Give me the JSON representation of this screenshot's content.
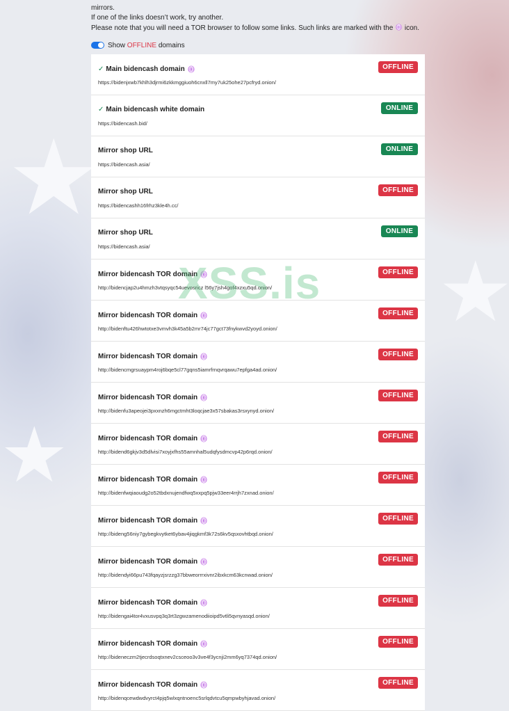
{
  "intro": {
    "line1": "mirrors.",
    "line2": "If one of the links doesn’t work, try another.",
    "line3_before": "Please note that you will need a TOR browser to follow some links. Such links are marked with the",
    "line3_after": "icon."
  },
  "toggle": {
    "label_prefix": "Show",
    "label_offline": "OFFLINE",
    "label_suffix": "domains",
    "enabled": true
  },
  "watermark": "XSS.is",
  "colors": {
    "offline": "#dc3545",
    "online": "#198754",
    "accent": "#1a73e8",
    "tor_icon": "#b24bd8"
  },
  "domains": [
    {
      "title": "Main bidencash domain",
      "url": "https://bidenjxwb7khlh3djrmi6zkkmggiuoh6cnxll7my7uk25ohe27pcfryd.onion/",
      "status": "OFFLINE",
      "tor": true,
      "checked": true
    },
    {
      "title": "Main bidencash white domain",
      "url": "https://bidencash.bid/",
      "status": "ONLINE",
      "tor": false,
      "checked": true
    },
    {
      "title": "Mirror shop URL",
      "url": "https://bidencash.asia/",
      "status": "ONLINE",
      "tor": false,
      "checked": false
    },
    {
      "title": "Mirror shop URL",
      "url": "https://bidencashh16frhz3kle4h.cc/",
      "status": "OFFLINE",
      "tor": false,
      "checked": false
    },
    {
      "title": "Mirror shop URL",
      "url": "https://bidencash.asia/",
      "status": "ONLINE",
      "tor": false,
      "checked": false
    },
    {
      "title": "Mirror bidencash TOR domain",
      "url": "http://bidencjap2u4hmzh3vtqsyqc54uevosricz l56y7jsh4gof4xzxu5qd.onion/",
      "status": "OFFLINE",
      "tor": true,
      "checked": false
    },
    {
      "title": "Mirror bidencash TOR domain",
      "url": "http://bidenftu426hwtotxe3vmvh3k45a5b2mr74jc77gct73fnykwvd2yoyd.onion/",
      "status": "OFFLINE",
      "tor": true,
      "checked": false
    },
    {
      "title": "Mirror bidencash TOR domain",
      "url": "http://bidencmgrsuaypm4roj6bqe5cl77gqns5iamrfrnqvrqawu7epfga4ad.onion/",
      "status": "OFFLINE",
      "tor": true,
      "checked": false
    },
    {
      "title": "Mirror bidencash TOR domain",
      "url": "http://bidenfu3apeojei3pxxnzh6mgctmht3loqcjae3x57sbakas3rsxynyd.onion/",
      "status": "OFFLINE",
      "tor": true,
      "checked": false
    },
    {
      "title": "Mirror bidencash TOR domain",
      "url": "http://bidend6gkjv3d5dlvisi7xoyjxfhs55amnhal5udqfysdmcvp42p6rqd.onion/",
      "status": "OFFLINE",
      "tor": true,
      "checked": false
    },
    {
      "title": "Mirror bidencash TOR domain",
      "url": "http://bidenfwqiaoudg2o52tbdxnujendfwq5xxpq5pjw33eer4rrjh7zxnad.onion/",
      "status": "OFFLINE",
      "tor": true,
      "checked": false
    },
    {
      "title": "Mirror bidencash TOR domain",
      "url": "http://bideng56niy7gybegkvytket6ybav4jiqgkmf3k72s6kv5qsxovhtbqd.onion/",
      "status": "OFFLINE",
      "tor": true,
      "checked": false
    },
    {
      "title": "Mirror bidencash TOR domain",
      "url": "http://bidendyi66pu743fqayzjsrzzg37bbweorrrxivnr2ibxkcm63kcnwad.onion/",
      "status": "OFFLINE",
      "tor": true,
      "checked": false
    },
    {
      "title": "Mirror bidencash TOR domain",
      "url": "http://bidengai4tor4vxusvpq3q3rt3zgwzamenodiioipd5vtli5qvnyasqd.onion/",
      "status": "OFFLINE",
      "tor": true,
      "checked": false
    },
    {
      "title": "Mirror bidencash TOR domain",
      "url": "http://bideneczm2tjecrdsoqtxnev2csceoo3v3ve4f3ycnji2mm6yq7374qd.onion/",
      "status": "OFFLINE",
      "tor": true,
      "checked": false
    },
    {
      "title": "Mirror bidencash TOR domain",
      "url": "http://bidenqcewdwdvyrct4pjq5wlxqntnoenc5srlqdvtcu5qmpwbyhjavad.onion/",
      "status": "OFFLINE",
      "tor": true,
      "checked": false
    }
  ]
}
